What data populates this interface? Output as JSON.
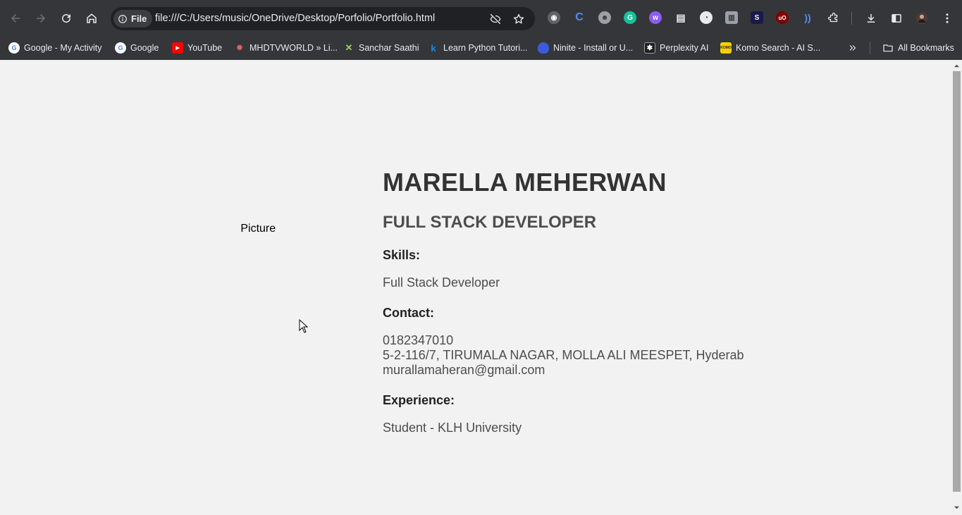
{
  "browser": {
    "site_chip": "File",
    "url": "file:///C:/Users/music/OneDrive/Desktop/Porfolio/Portfolio.html",
    "bookmarks": [
      {
        "label": "Google - My Activity",
        "icon": "google-icon"
      },
      {
        "label": "Google",
        "icon": "google-icon"
      },
      {
        "label": "YouTube",
        "icon": "youtube-icon"
      },
      {
        "label": "MHDTVWORLD » Li...",
        "icon": "mhdtvworld-icon"
      },
      {
        "label": "Sanchar Saathi",
        "icon": "sanchar-saathi-icon"
      },
      {
        "label": "Learn Python Tutori...",
        "icon": "python-tutorial-icon"
      },
      {
        "label": "Ninite - Install or U...",
        "icon": "ninite-icon"
      },
      {
        "label": "Perplexity AI",
        "icon": "perplexity-icon"
      },
      {
        "label": "Komo Search - AI S...",
        "icon": "komo-icon"
      }
    ],
    "all_bookmarks_label": "All Bookmarks"
  },
  "page": {
    "profile_picture_alt": "e Picture",
    "name": "MARELLA MEHERWAN",
    "role": "FULL STACK DEVELOPER",
    "skills_heading": "Skills:",
    "skills_text": "Full Stack Developer",
    "contact_heading": "Contact:",
    "contact_phone": "0182347010",
    "contact_address": "5-2-116/7, TIRUMALA NAGAR, MOLLA ALI MEESPET, Hyderab",
    "contact_email": "murallamaheran@gmail.com",
    "experience_heading": "Experience:",
    "experience_text": "Student - KLH University"
  },
  "colors": {
    "toolbar_bg": "#35363a",
    "page_bg": "#f2f2f2",
    "heading_text": "#333333",
    "body_text": "#4d4d4d"
  }
}
